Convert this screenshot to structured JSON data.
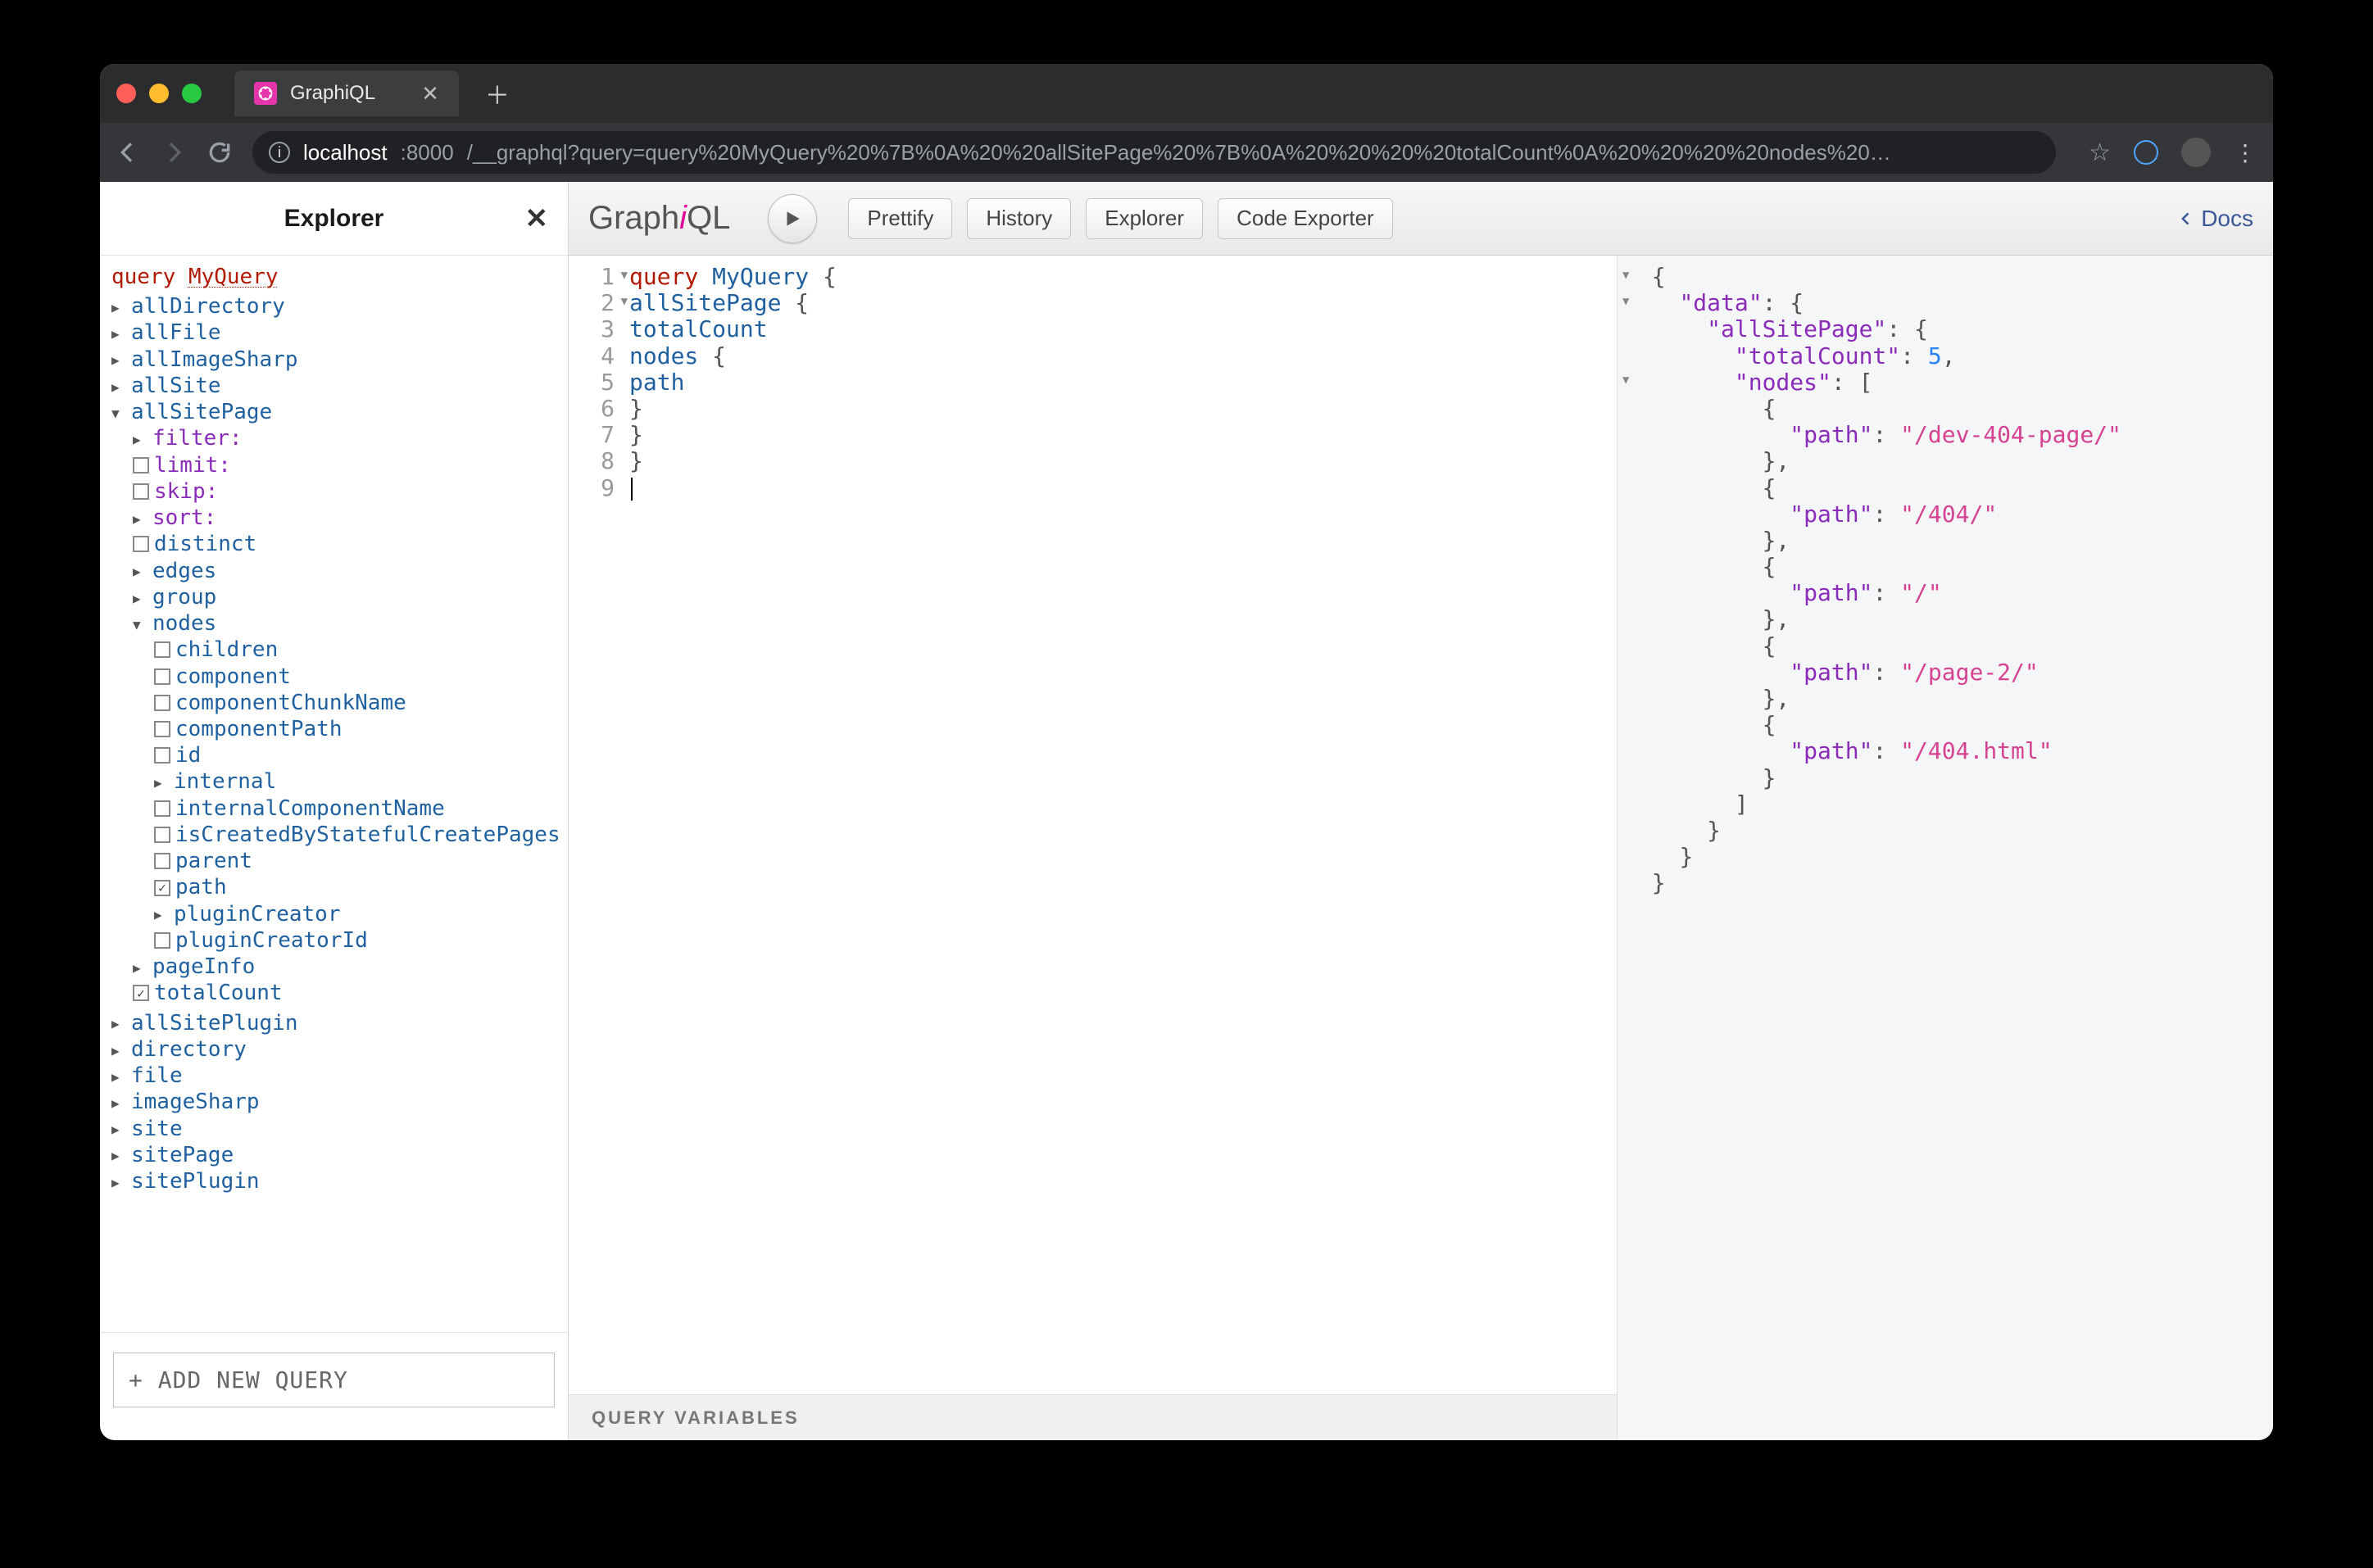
{
  "browser": {
    "tab_title": "GraphiQL",
    "url_host": "localhost",
    "url_port": ":8000",
    "url_path": "/__graphql?query=query%20MyQuery%20%7B%0A%20%20allSitePage%20%7B%0A%20%20%20%20totalCount%0A%20%20%20%20nodes%20…"
  },
  "explorer": {
    "title": "Explorer",
    "query_keyword": "query",
    "query_name": "MyQuery",
    "top": [
      "allDirectory",
      "allFile",
      "allImageSharp",
      "allSite"
    ],
    "allSitePage": {
      "label": "allSitePage",
      "args": {
        "filter": "filter:",
        "limit": "limit:",
        "skip": "skip:",
        "sort": "sort:"
      },
      "fields": {
        "distinct": "distinct",
        "edges": "edges",
        "group": "group",
        "nodes": "nodes",
        "node_children": [
          "children",
          "component",
          "componentChunkName",
          "componentPath",
          "id",
          "internal",
          "internalComponentName",
          "isCreatedByStatefulCreatePages",
          "parent",
          "path",
          "pluginCreator",
          "pluginCreatorId"
        ],
        "pageInfo": "pageInfo",
        "totalCount": "totalCount"
      }
    },
    "bottom": [
      "allSitePlugin",
      "directory",
      "file",
      "imageSharp",
      "site",
      "sitePage",
      "sitePlugin"
    ],
    "add_new": "+ ADD NEW QUERY"
  },
  "toolbar": {
    "logo_a": "Graph",
    "logo_i": "i",
    "logo_b": "QL",
    "prettify": "Prettify",
    "history": "History",
    "explorer": "Explorer",
    "code_exporter": "Code Exporter",
    "docs": "Docs"
  },
  "editor": {
    "lines": [
      {
        "n": "1",
        "t": "query MyQuery {",
        "fold": true
      },
      {
        "n": "2",
        "t": "  allSitePage {",
        "fold": true
      },
      {
        "n": "3",
        "t": "    totalCount"
      },
      {
        "n": "4",
        "t": "    nodes {"
      },
      {
        "n": "5",
        "t": "      path"
      },
      {
        "n": "6",
        "t": "    }"
      },
      {
        "n": "7",
        "t": "  }"
      },
      {
        "n": "8",
        "t": "}"
      },
      {
        "n": "9",
        "t": ""
      }
    ]
  },
  "qvars": {
    "label": "QUERY VARIABLES"
  },
  "result": {
    "data_key": "data",
    "allSitePage_key": "allSitePage",
    "totalCount_key": "totalCount",
    "totalCount_val": "5",
    "nodes_key": "nodes",
    "path_key": "path",
    "paths": [
      "/dev-404-page/",
      "/404/",
      "/",
      "/page-2/",
      "/404.html"
    ]
  }
}
